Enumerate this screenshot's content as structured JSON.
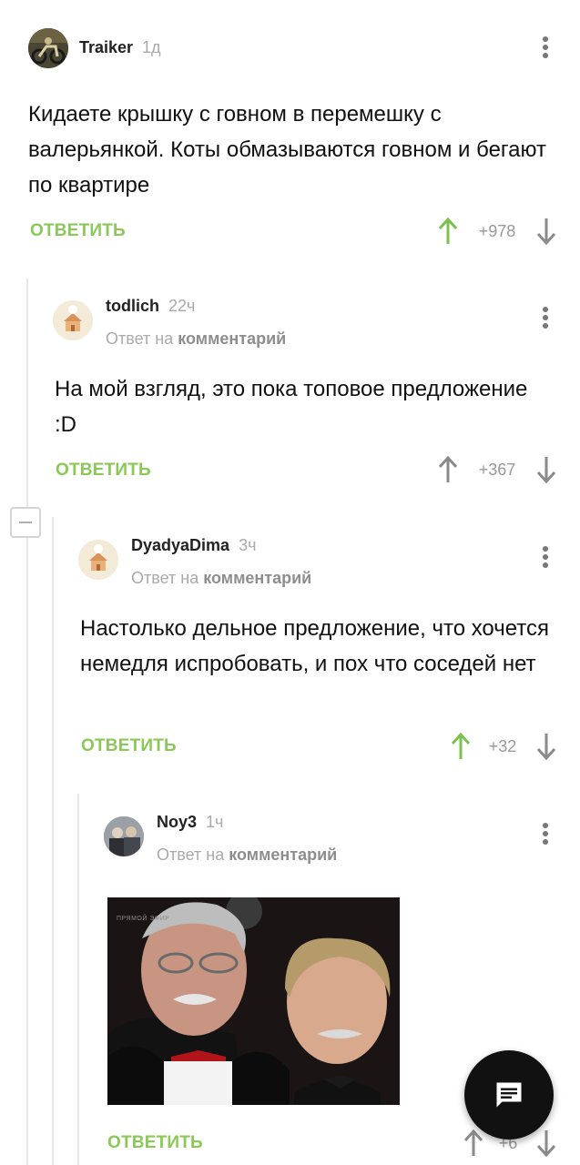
{
  "comments": [
    {
      "author": "Traiker",
      "time": "1д",
      "reply_to": null,
      "text": "Кидаете крышку с говном в перемешку с валерьянкой. Коты обмазываются говном и бегают по квартире",
      "reply_label": "ОТВЕТИТЬ",
      "score": "+978",
      "avatar_icon": "avatar-motorcycle",
      "vote_up_active": true
    },
    {
      "author": "todlich",
      "time": "22ч",
      "reply_to": {
        "prefix": "Ответ на",
        "link": "комментарий"
      },
      "text": "На мой взгляд, это пока топовое предложение :D",
      "reply_label": "ОТВЕТИТЬ",
      "score": "+367",
      "avatar_icon": "avatar-chef-house",
      "vote_up_active": false
    },
    {
      "author": "DyadyaDima",
      "time": "3ч",
      "reply_to": {
        "prefix": "Ответ на",
        "link": "комментарий"
      },
      "text": "Настолько дельное предложение, что хочется немедля испробовать, и пох что соседей нет",
      "reply_label": "ОТВЕТИТЬ",
      "score": "+32",
      "avatar_icon": "avatar-chef-house",
      "vote_up_active": true
    },
    {
      "author": "Noy3",
      "time": "1ч",
      "reply_to": {
        "prefix": "Ответ на",
        "link": "комментарий"
      },
      "image_label": "ПРЯМОЙ ЭФИР",
      "reply_label": "ОТВЕТИТЬ",
      "score": "+6",
      "avatar_icon": "avatar-photo",
      "vote_up_active": false
    }
  ],
  "colors": {
    "accent_green": "#8ac858",
    "upvote_active": "#7cc04f",
    "muted": "#aaaaaa",
    "fab": "#111111"
  },
  "fab_icon": "comment-icon"
}
